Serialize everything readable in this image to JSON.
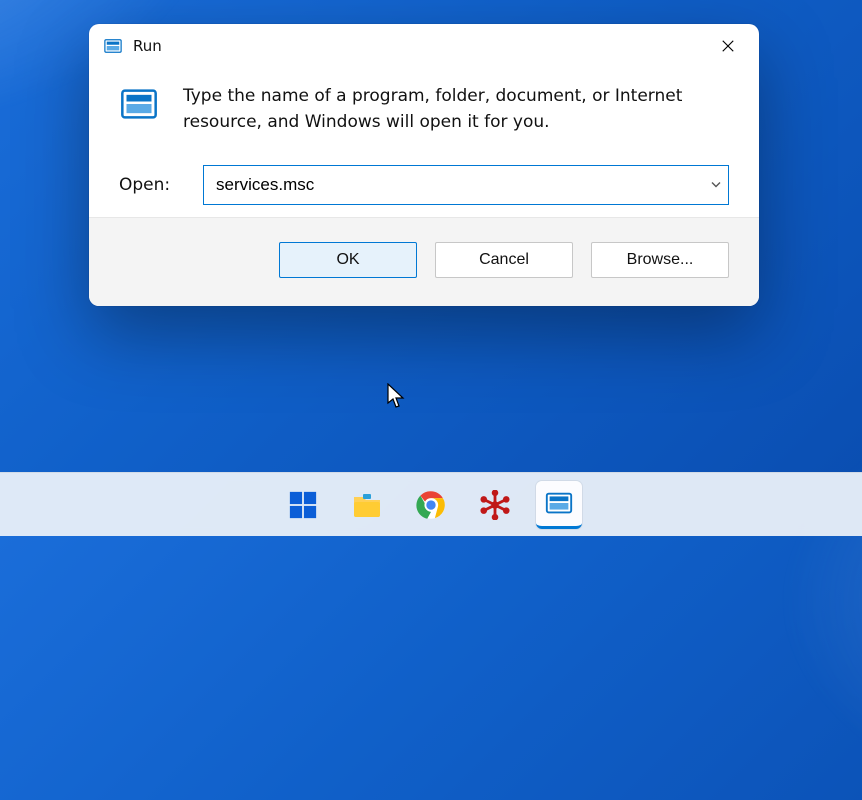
{
  "dialog": {
    "title": "Run",
    "description": "Type the name of a program, folder, document, or Internet resource, and Windows will open it for you.",
    "open_label": "Open:",
    "open_value": "services.msc",
    "buttons": {
      "ok": "OK",
      "cancel": "Cancel",
      "browse": "Browse..."
    }
  },
  "taskbar": {
    "items": [
      {
        "name": "start",
        "active": false
      },
      {
        "name": "file-explorer",
        "active": false
      },
      {
        "name": "chrome",
        "active": false
      },
      {
        "name": "filezilla",
        "active": false
      },
      {
        "name": "run",
        "active": true
      }
    ]
  }
}
